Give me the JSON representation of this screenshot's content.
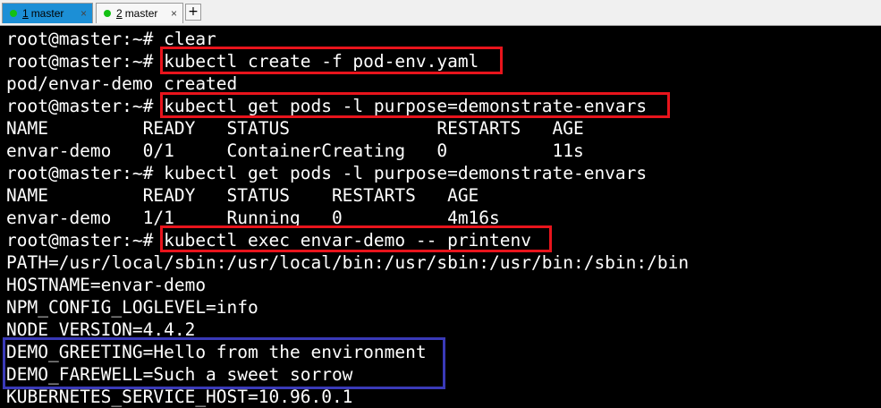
{
  "tabs": [
    {
      "number": "1",
      "label": "master",
      "active": true
    },
    {
      "number": "2",
      "label": "master",
      "active": false
    }
  ],
  "tab_close_glyph": "×",
  "tab_add_glyph": "+",
  "colors": {
    "active_tab": "#1c8fd6",
    "status_dot": "#14c114",
    "highlight_red": "#e8141c",
    "highlight_blue": "#3a3ab8",
    "terminal_bg": "#000000",
    "terminal_fg": "#ffffff"
  },
  "terminal": {
    "lines": [
      "root@master:~# clear",
      "root@master:~# kubectl create -f pod-env.yaml",
      "pod/envar-demo created",
      "root@master:~# kubectl get pods -l purpose=demonstrate-envars",
      "NAME         READY   STATUS              RESTARTS   AGE",
      "envar-demo   0/1     ContainerCreating   0          11s",
      "root@master:~# kubectl get pods -l purpose=demonstrate-envars",
      "NAME         READY   STATUS    RESTARTS   AGE",
      "envar-demo   1/1     Running   0          4m16s",
      "root@master:~# kubectl exec envar-demo -- printenv",
      "PATH=/usr/local/sbin:/usr/local/bin:/usr/sbin:/usr/bin:/sbin:/bin",
      "HOSTNAME=envar-demo",
      "NPM_CONFIG_LOGLEVEL=info",
      "NODE_VERSION=4.4.2",
      "DEMO_GREETING=Hello from the environment",
      "DEMO_FAREWELL=Such a sweet sorrow",
      "KUBERNETES_SERVICE_HOST=10.96.0.1"
    ]
  }
}
